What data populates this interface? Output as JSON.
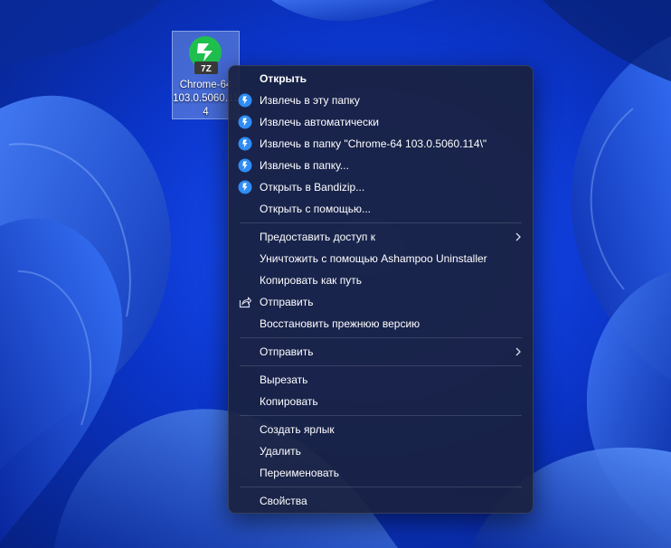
{
  "desktop_icon": {
    "badge": "7Z",
    "label_lines": [
      "Chrome-64",
      "103.0.5060.11",
      "4"
    ]
  },
  "menu": {
    "open": "Открыть",
    "extract_here": "Извлечь в эту папку",
    "extract_auto": "Извлечь автоматически",
    "extract_to_folder": "Извлечь в папку \"Chrome-64 103.0.5060.114\\\"",
    "extract_to": "Извлечь в папку...",
    "open_in_bandizip": "Открыть в Bandizip...",
    "open_with": "Открыть с помощью...",
    "grant_access": "Предоставить доступ к",
    "ashampoo_uninstall": "Уничтожить с помощью Ashampoo Uninstaller",
    "copy_as_path": "Копировать как путь",
    "share": "Отправить",
    "restore_previous": "Восстановить прежнюю версию",
    "send_to": "Отправить",
    "cut": "Вырезать",
    "copy": "Копировать",
    "create_shortcut": "Создать ярлык",
    "delete": "Удалить",
    "rename": "Переименовать",
    "properties": "Свойства"
  },
  "icons": {
    "bandizip": "bandizip-icon",
    "share": "share-icon",
    "submenu": "chevron-right-icon",
    "file": "7z-archive-icon"
  },
  "colors": {
    "wallpaper": "#0a2fb8",
    "menu_bg": "#1a2140",
    "bandizip_blue": "#2f8cf5",
    "archive_green": "#1fbf4e"
  }
}
